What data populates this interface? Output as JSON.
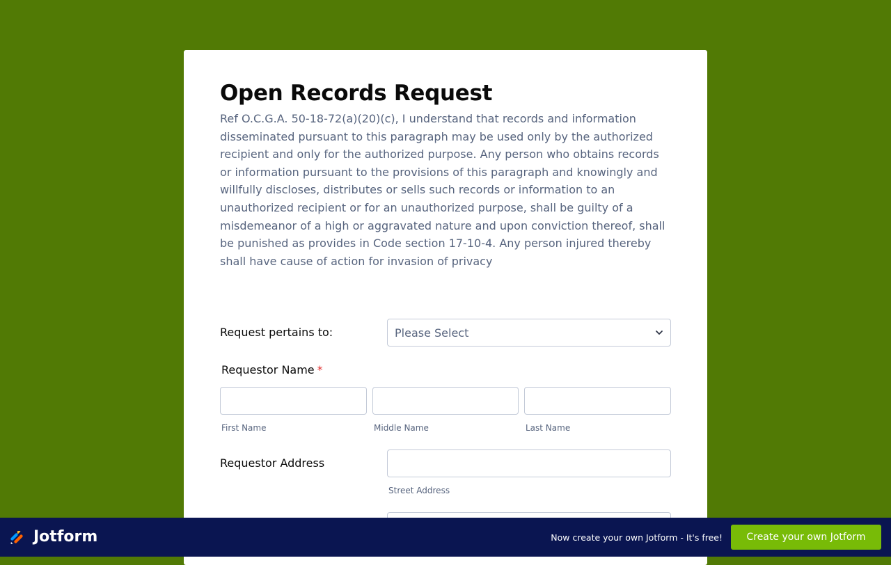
{
  "form": {
    "title": "Open Records Request",
    "description": "Ref O.C.G.A. 50-18-72(a)(20)(c), I understand that records and information disseminated pursuant to this paragraph may be used only by the authorized recipient and only for the authorized purpose. Any person who obtains records or information pursuant to the provisions of this paragraph and knowingly and willfully discloses, distributes or sells such records or information to an unauthorized recipient or for an unauthorized purpose, shall be guilty of a misdemeanor of a high or aggravated nature and upon conviction thereof, shall be punished as provides in Code section 17-10-4. Any person injured thereby shall have cause of action for invasion of privacy",
    "request_pertains": {
      "label": "Request pertains to:",
      "selected": "Please Select"
    },
    "requestor_name": {
      "label": "Requestor Name",
      "required_mark": "*",
      "first_name": {
        "value": "",
        "sublabel": "First Name"
      },
      "middle_name": {
        "value": "",
        "sublabel": "Middle Name"
      },
      "last_name": {
        "value": "",
        "sublabel": "Last Name"
      }
    },
    "requestor_address": {
      "label": "Requestor Address",
      "street_address": {
        "value": "",
        "sublabel": "Street Address"
      }
    }
  },
  "footer": {
    "logo_text": "Jotform",
    "tagline": "Now create your own Jotform - It's free!",
    "cta_label": "Create your own Jotform"
  },
  "colors": {
    "page_background": "#517a05",
    "footer_background": "#0a1551",
    "cta_background": "#78bb07",
    "required_star": "#e12b2b"
  },
  "icons": {
    "select_chevron": "chevron-down-icon",
    "logo": "jotform-logo-icon"
  }
}
